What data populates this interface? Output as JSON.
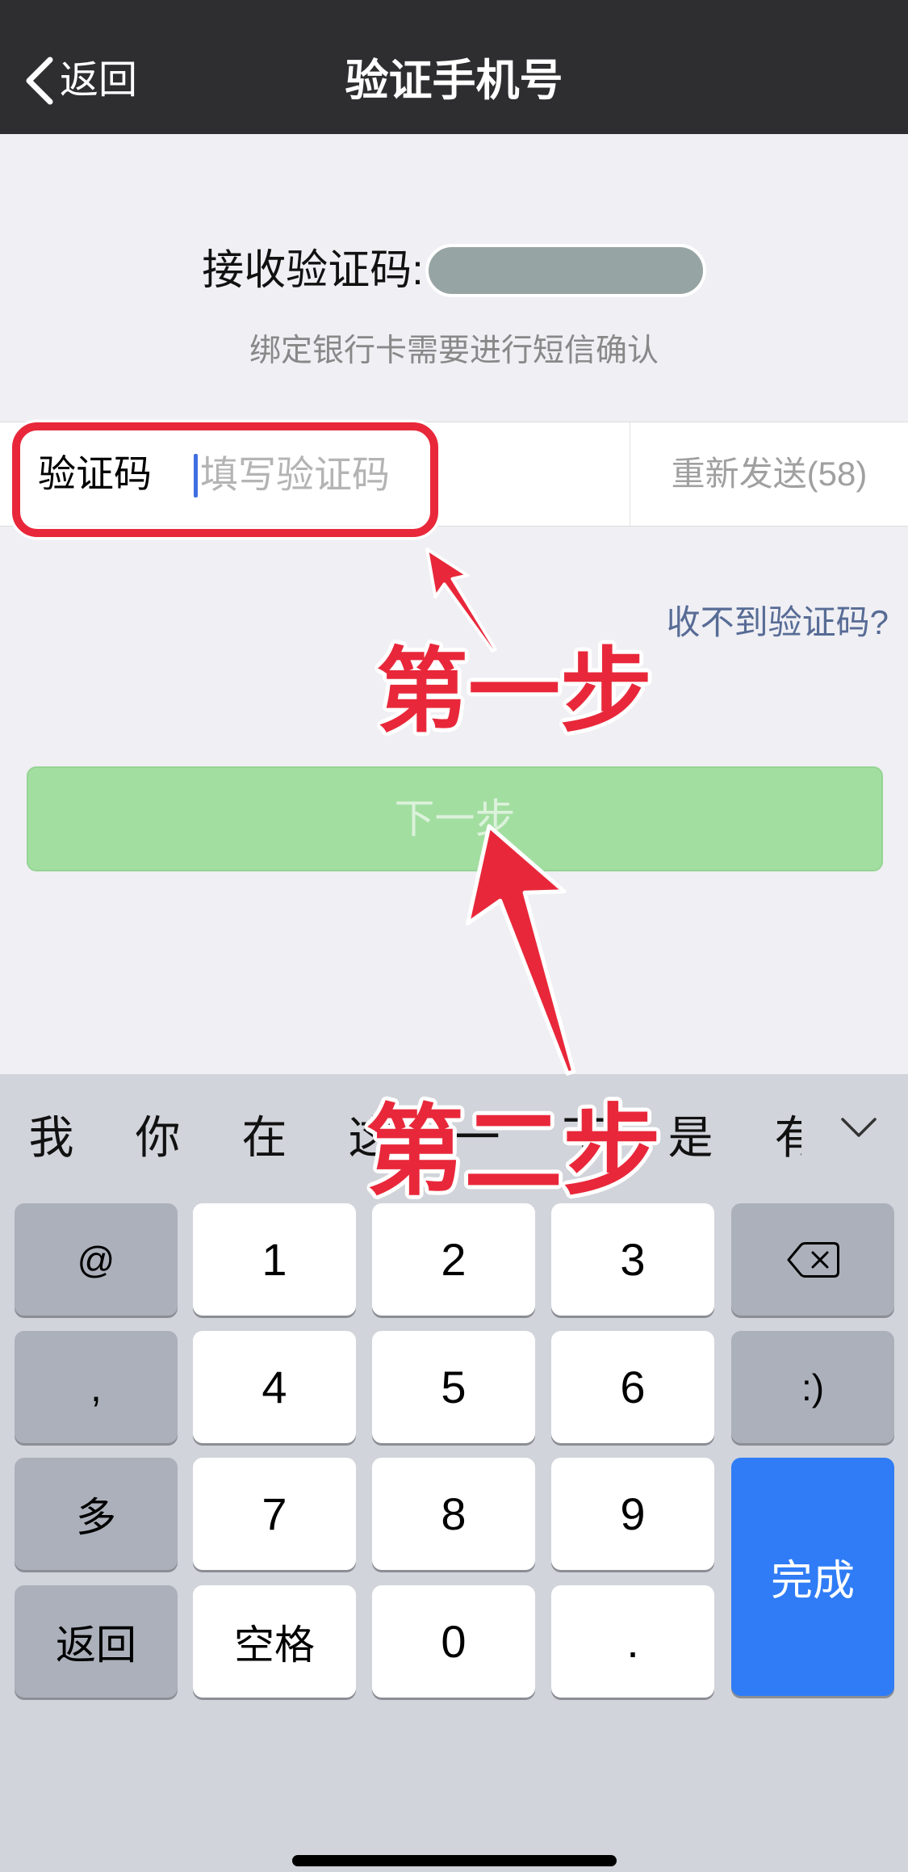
{
  "nav": {
    "back_icon": "chevron-left-icon",
    "back_label": "返回",
    "title": "验证手机号"
  },
  "verify": {
    "receive_label": "接收验证码:",
    "hint": "绑定银行卡需要进行短信确认"
  },
  "code_field": {
    "label": "验证码",
    "placeholder": "填写验证码",
    "value": "",
    "resend_label": "重新发送(58)"
  },
  "help_link": "收不到验证码?",
  "next_button": {
    "label": "下一步",
    "enabled": false
  },
  "keyboard": {
    "candidates": [
      "我",
      "你",
      "在",
      "这",
      "一",
      "不",
      "是",
      "有"
    ],
    "collapse_icon": "chevron-down-icon",
    "rows": [
      [
        "@",
        "1",
        "2",
        "3"
      ],
      [
        ",",
        "4",
        "5",
        "6",
        ":)"
      ],
      [
        "多",
        "7",
        "8",
        "9"
      ],
      [
        "返回",
        "空格",
        "0",
        "."
      ]
    ],
    "delete_icon": "delete-icon",
    "done_label": "完成"
  },
  "annotations": {
    "step1": "第一步",
    "step2": "第二步"
  },
  "colors": {
    "nav_bg": "#2e2e30",
    "page_bg": "#efeff4",
    "link": "#576b95",
    "button_disabled": "#a3dea1",
    "keyboard_bg": "#d1d4da",
    "key_bg": "#ffffff",
    "function_key_bg": "#abb0ba",
    "done_key": "#2f7cf6",
    "annotation_red": "#e8283a",
    "cursor": "#3f6fe0"
  }
}
